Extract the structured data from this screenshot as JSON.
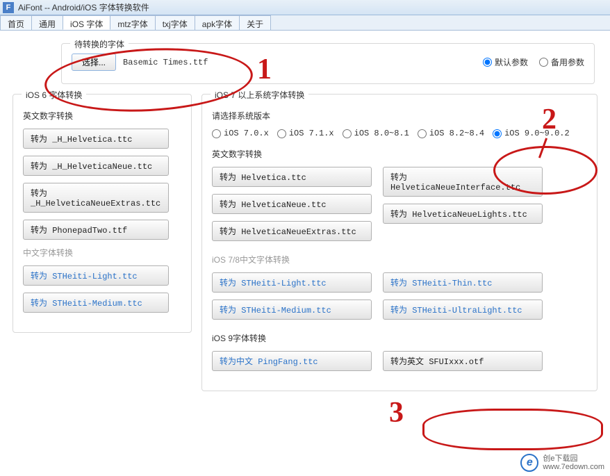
{
  "window": {
    "icon_letter": "F",
    "title": "AiFont -- Android/iOS 字体转换软件"
  },
  "tabs": [
    {
      "label": "首页"
    },
    {
      "label": "通用"
    },
    {
      "label": "iOS 字体",
      "active": true
    },
    {
      "label": "mtz字体"
    },
    {
      "label": "txj字体"
    },
    {
      "label": "apk字体"
    },
    {
      "label": "关于"
    }
  ],
  "top_group": {
    "title": "待转换的字体",
    "select_button": "选择...",
    "filename": "Basemic Times.ttf",
    "radios": [
      {
        "label": "默认参数",
        "checked": true
      },
      {
        "label": "备用参数",
        "checked": false
      }
    ]
  },
  "ios6": {
    "title": "iOS 6 字体转换",
    "eng_heading": "英文数字转换",
    "eng_buttons": [
      "转为 _H_Helvetica.ttc",
      "转为 _H_HelveticaNeue.ttc",
      "转为 _H_HelveticaNeueExtras.ttc",
      "转为 PhonepadTwo.ttf"
    ],
    "cn_heading": "中文字体转换",
    "cn_buttons": [
      "转为 STHeiti-Light.ttc",
      "转为 STHeiti-Medium.ttc"
    ]
  },
  "ios7": {
    "title": "iOS 7 以上系统字体转换",
    "version_heading": "请选择系统版本",
    "versions": [
      {
        "label": "iOS 7.0.x"
      },
      {
        "label": "iOS 7.1.x"
      },
      {
        "label": "iOS 8.0~8.1"
      },
      {
        "label": "iOS 8.2~8.4"
      },
      {
        "label": "iOS 9.0~9.0.2",
        "checked": true
      }
    ],
    "eng_heading": "英文数字转换",
    "eng_left": [
      "转为 Helvetica.ttc",
      "转为 HelveticaNeue.ttc",
      "转为 HelveticaNeueExtras.ttc"
    ],
    "eng_right": [
      "转为 HelveticaNeueInterface.ttc",
      "转为 HelveticaNeueLights.ttc"
    ],
    "cn78_heading": "iOS 7/8中文字体转换",
    "cn78_left": [
      "转为 STHeiti-Light.ttc",
      "转为 STHeiti-Medium.ttc"
    ],
    "cn78_right": [
      "转为 STHeiti-Thin.ttc",
      "转为 STHeiti-UltraLight.ttc"
    ],
    "ios9_heading": "iOS 9字体转换",
    "ios9_left": "转为中文 PingFang.ttc",
    "ios9_right": "转为英文 SFUIxxx.otf"
  },
  "annotations": {
    "n1": "1",
    "n2": "2",
    "n3": "3"
  },
  "watermark": {
    "line1": "创e下载园",
    "line2": "www.7edown.com"
  }
}
